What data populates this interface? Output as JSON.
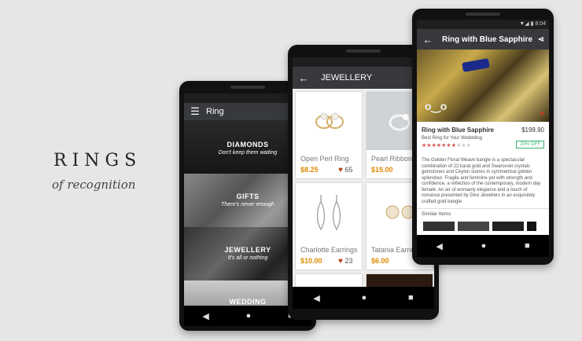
{
  "brand": {
    "title": "RINGS",
    "subtitle": "of recognition"
  },
  "phone1": {
    "appbar_title": "Ring",
    "categories": [
      {
        "title": "DIAMONDS",
        "subtitle": "Don't keep them waiting"
      },
      {
        "title": "GIFTS",
        "subtitle": "There's never enough"
      },
      {
        "title": "JEWELLERY",
        "subtitle": "It's all or nothing"
      },
      {
        "title": "WEDDING",
        "subtitle": ""
      }
    ]
  },
  "phone2": {
    "appbar_title": "JEWELLERY",
    "products": [
      {
        "name": "Open Perl Ring",
        "price": "$8.25",
        "likes": "65"
      },
      {
        "name": "Pearl Ribbon N",
        "price": "$15.00",
        "likes": ""
      },
      {
        "name": "Charlotte Earrings",
        "price": "$10.00",
        "likes": "23"
      },
      {
        "name": "Tatania Earring",
        "price": "$6.00",
        "likes": ""
      }
    ]
  },
  "phone3": {
    "status_time": "8:04",
    "appbar_title": "Ring with Blue Sapphire",
    "product_name": "Ring with Blue Sapphire",
    "price": "$199.90",
    "tagline": "Best Ring for Your Weddding",
    "discount": "20% OFF",
    "rating": 7,
    "rating_max": 10,
    "description": "The Golden Floral Weave bangle is a spectacular combination of 22 karat gold and Swarovski crystals gemstones and Ceylon stones in symmetrical golden splendour. Fragile and feminine yet with strength and confidence, a reflection of the contemporary, modern day female. An air of womanly elegance and a touch of romance presented by Devi Jewellers in an exquisitely crafted gold bangle",
    "similar_label": "Similar Items"
  },
  "icons": {
    "back": "arrow-back-icon",
    "menu": "menu-icon",
    "share": "share-icon",
    "heart": "heart-icon",
    "nav_back": "nav-back-icon",
    "nav_home": "nav-home-icon",
    "nav_recent": "nav-recent-icon"
  },
  "colors": {
    "appbar": "#37393d",
    "price": "#e08a00",
    "heart": "#b7411e",
    "discount": "#3cb371"
  }
}
